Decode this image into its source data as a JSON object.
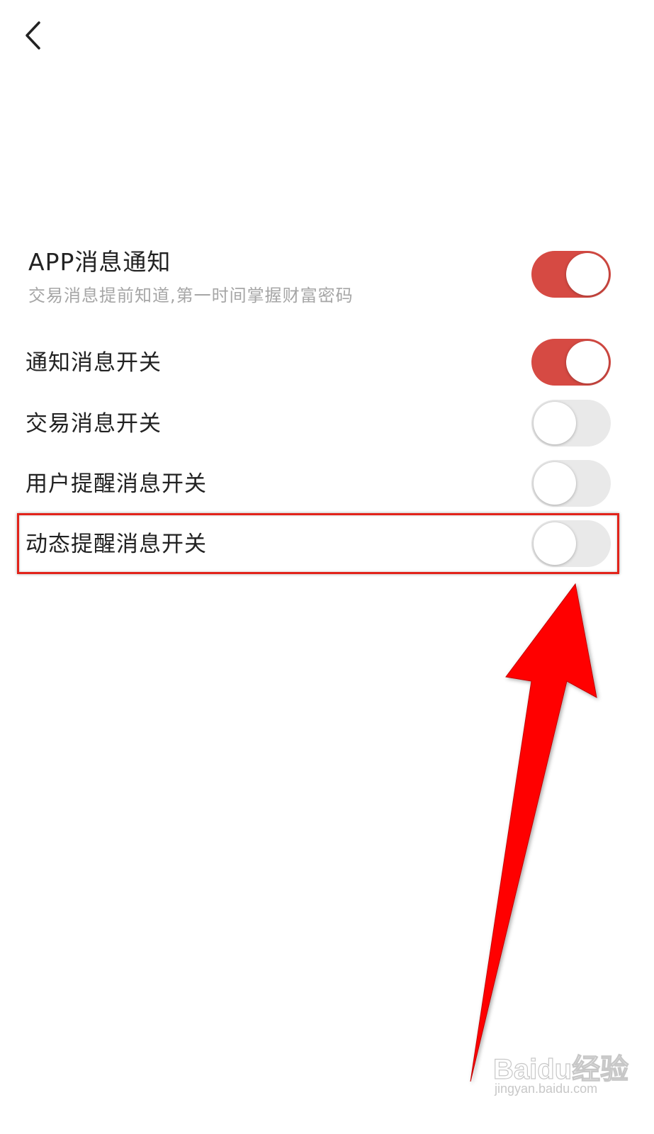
{
  "header": {
    "back_icon": "chevron-left-icon"
  },
  "app_notification": {
    "title": "APP消息通知",
    "subtitle": "交易消息提前知道,第一时间掌握财富密码",
    "enabled": true
  },
  "settings": [
    {
      "label": "通知消息开关",
      "enabled": true
    },
    {
      "label": "交易消息开关",
      "enabled": false
    },
    {
      "label": "用户提醒消息开关",
      "enabled": false
    },
    {
      "label": "动态提醒消息开关",
      "enabled": false
    }
  ],
  "colors": {
    "toggle_on": "#d64a43",
    "toggle_off": "#e9e9e9",
    "annotation_red": "#e2231a"
  },
  "annotation": {
    "highlighted_item": "动态提醒消息开关"
  },
  "watermark": {
    "brand": "Baidu经验",
    "url": "jingyan.baidu.com"
  }
}
